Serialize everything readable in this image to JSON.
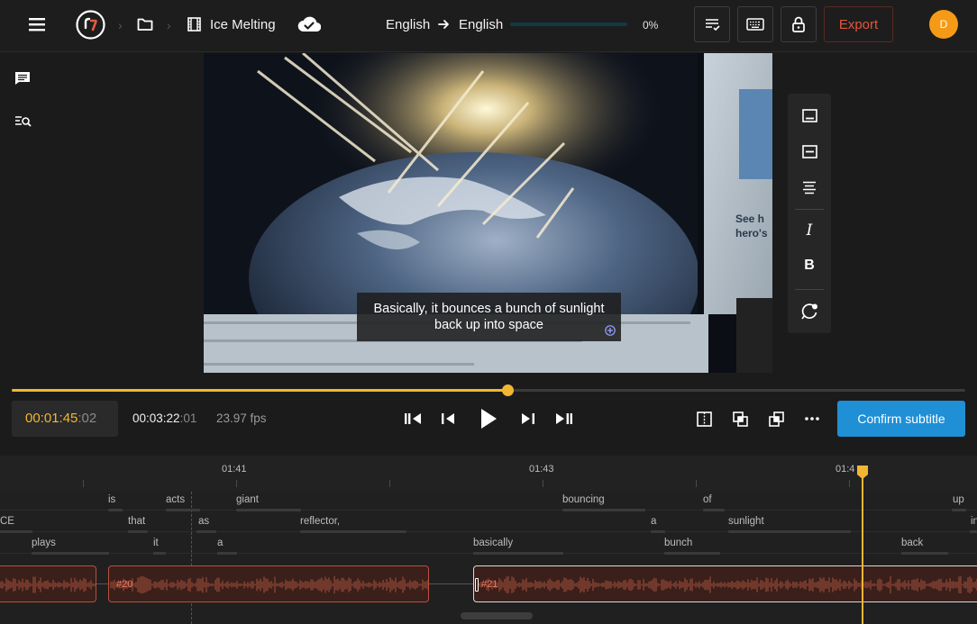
{
  "header": {
    "project_title": "Ice Melting",
    "source_language": "English",
    "target_language": "English",
    "progress_percent_label": "0%",
    "progress": 0,
    "export_label": "Export",
    "avatar_initial": "D",
    "icons": [
      "menu-icon",
      "logo-icon",
      "folder-icon",
      "film-icon",
      "cloud-check-icon",
      "arrow-right-icon",
      "checklist-icon",
      "keyboard-icon",
      "lock-icon"
    ]
  },
  "sidebar": {
    "icons": [
      "comment-icon",
      "search-list-icon"
    ]
  },
  "video": {
    "subtitle_line1": "Basically, it bounces a bunch of sunlight",
    "subtitle_line2": "back up into space",
    "move_handle_icon": "move-icon"
  },
  "format_panel": {
    "icons": [
      "align-bottom-icon",
      "align-middle-icon",
      "align-text-icon",
      "italic-icon",
      "bold-icon",
      "color-picker-icon"
    ],
    "italic_glyph": "I",
    "bold_glyph": "B"
  },
  "player": {
    "current_time_main": "00:01:45",
    "current_time_frames": ":02",
    "duration_main": "00:03:22",
    "duration_frames": ":01",
    "fps": "23.97 fps",
    "scrub_progress": 0.52,
    "confirm_label": "Confirm subtitle",
    "icons": [
      "skip-back-icon",
      "step-back-icon",
      "play-icon",
      "step-forward-icon",
      "skip-forward-icon",
      "split-icon",
      "merge-icon",
      "overlap-icon",
      "more-icon"
    ]
  },
  "timeline": {
    "ticks": [
      "01:41",
      "01:43",
      "01:4"
    ],
    "row1": [
      {
        "text": "is",
        "bar_w": 16
      },
      {
        "text": "acts",
        "bar_w": 38
      },
      {
        "text": "giant",
        "bar_w": 72
      },
      {
        "text": "bouncing",
        "bar_w": 92
      },
      {
        "text": "of",
        "bar_w": 24
      },
      {
        "text": "up",
        "bar_w": 16
      }
    ],
    "row2": [
      {
        "text": "CE",
        "bar_w": 36
      },
      {
        "text": "that",
        "bar_w": 22
      },
      {
        "text": "as",
        "bar_w": 22
      },
      {
        "text": "reflector,",
        "bar_w": 118
      },
      {
        "text": "a",
        "bar_w": 16
      },
      {
        "text": "sunlight",
        "bar_w": 136
      },
      {
        "text": "in",
        "bar_w": 8
      }
    ],
    "row3": [
      {
        "text": "plays",
        "bar_w": 86
      },
      {
        "text": "it",
        "bar_w": 14
      },
      {
        "text": "a",
        "bar_w": 22
      },
      {
        "text": "basically",
        "bar_w": 100
      },
      {
        "text": "bunch",
        "bar_w": 62
      },
      {
        "text": "back",
        "bar_w": 52
      }
    ],
    "clips": [
      {
        "label": "",
        "state": "normal"
      },
      {
        "label": "#20",
        "state": "normal"
      },
      {
        "label": "#21",
        "state": "selected"
      }
    ],
    "playhead_icon": "playhead-marker-icon"
  }
}
